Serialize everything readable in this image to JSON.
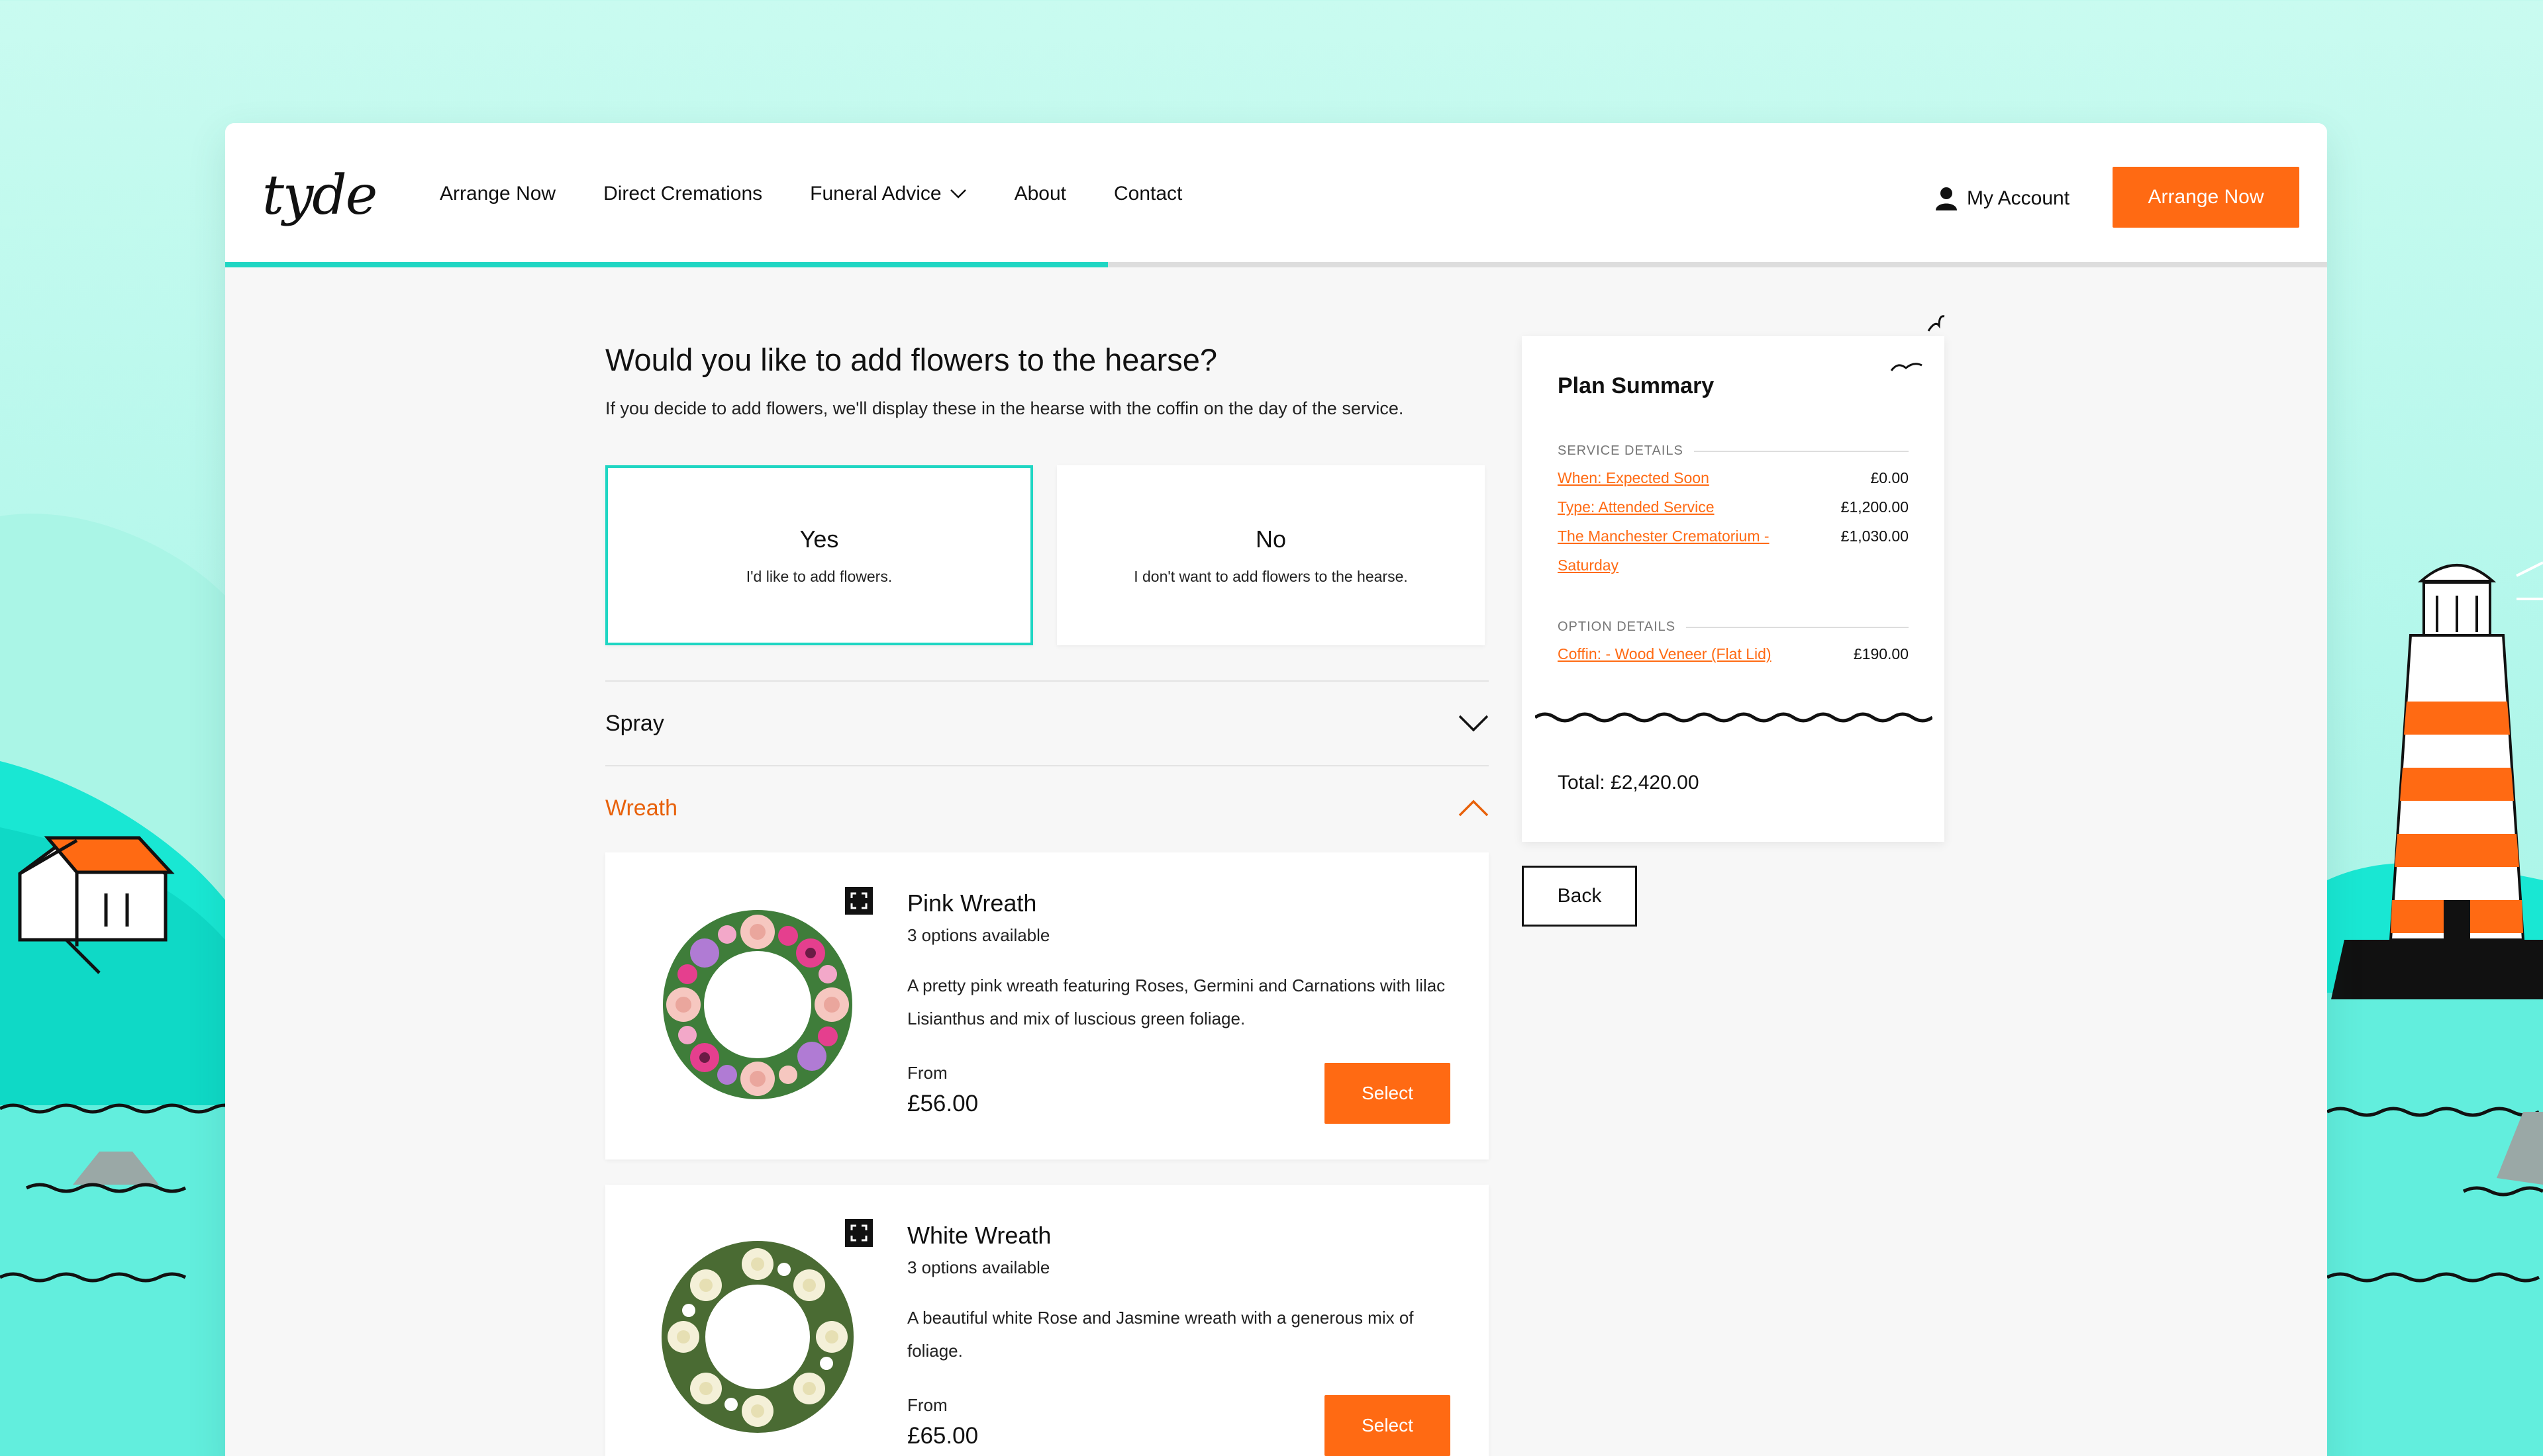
{
  "app": {
    "logo": "tyde"
  },
  "nav": {
    "items": [
      {
        "label": "Arrange Now"
      },
      {
        "label": "Direct Cremations"
      },
      {
        "label": "Funeral Advice",
        "has_dropdown": true
      },
      {
        "label": "About"
      },
      {
        "label": "Contact"
      }
    ],
    "account_label": "My Account",
    "cta_label": "Arrange Now"
  },
  "progress": {
    "fraction": 0.42
  },
  "question": {
    "title": "Would you like to add flowers to the hearse?",
    "subtitle": "If you decide to add flowers, we'll display these in the hearse with the coffin on the day of the service."
  },
  "choices": [
    {
      "title": "Yes",
      "subtitle": "I'd like to add flowers.",
      "selected": true
    },
    {
      "title": "No",
      "subtitle": "I don't want to add flowers to the hearse.",
      "selected": false
    }
  ],
  "accordions": [
    {
      "label": "Spray",
      "expanded": false
    },
    {
      "label": "Wreath",
      "expanded": true
    }
  ],
  "products": [
    {
      "name": "Pink Wreath",
      "options": "3 options available",
      "description": "A pretty pink wreath featuring Roses, Germini and Carnations with lilac Lisianthus and mix of luscious green foliage.",
      "from_label": "From",
      "price": "£56.00",
      "button": "Select"
    },
    {
      "name": "White Wreath",
      "options": "3 options available",
      "description": "A beautiful white Rose and Jasmine wreath with a generous mix of foliage.",
      "from_label": "From",
      "price": "£65.00",
      "button": "Select"
    }
  ],
  "summary": {
    "title": "Plan Summary",
    "service_heading": "SERVICE DETAILS",
    "service_items": [
      {
        "label": "When: Expected Soon",
        "value": "£0.00"
      },
      {
        "label": "Type: Attended Service",
        "value": "£1,200.00"
      },
      {
        "label": "The Manchester Crematorium - Saturday",
        "value": "£1,030.00"
      }
    ],
    "option_heading": "OPTION DETAILS",
    "option_items": [
      {
        "label": "Coffin: - Wood Veneer (Flat Lid)",
        "value": "£190.00"
      }
    ],
    "total": "Total: £2,420.00"
  },
  "back_label": "Back",
  "colors": {
    "accent": "#ff6a13",
    "teal": "#1fd6c3",
    "background": "#b3f7eb"
  },
  "icons": [
    "user-icon",
    "chevron-down-icon",
    "chevron-up-icon",
    "expand-icon",
    "bird-icon"
  ]
}
